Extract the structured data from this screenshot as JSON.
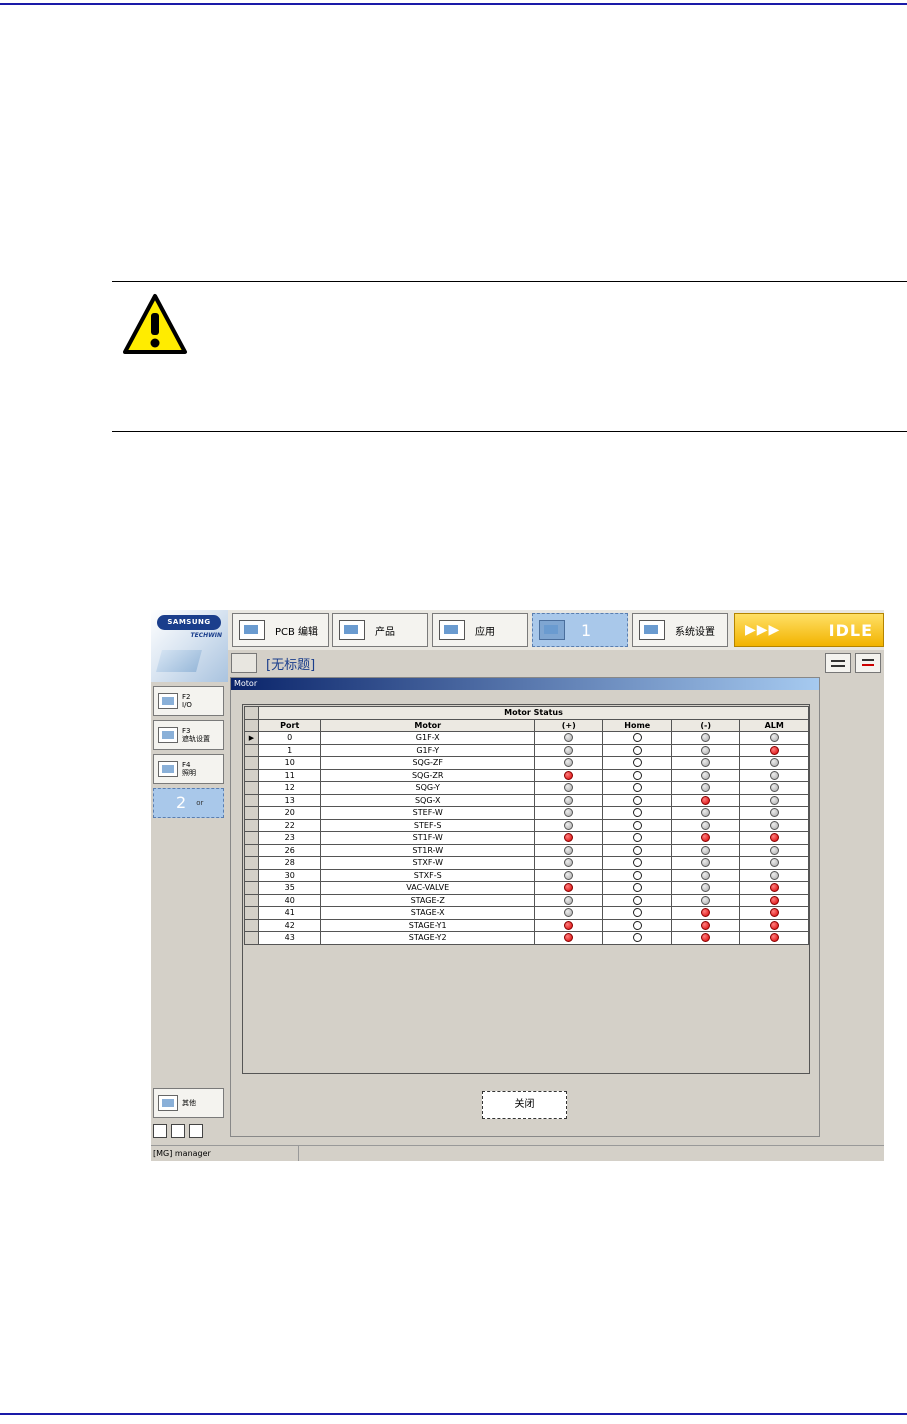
{
  "app": {
    "logo_brand": "SAMSUNG",
    "logo_sub": "TECHWIN",
    "tabs": [
      {
        "label": "PCB 编辑"
      },
      {
        "label": "产品"
      },
      {
        "label": "应用"
      },
      {
        "label": "1"
      },
      {
        "label": "系统设置"
      }
    ],
    "idle_arrows": "▶▶▶",
    "idle_label": "IDLE",
    "document_title": "[无标题]",
    "sidebar": [
      {
        "key": "F2",
        "label": "I/O"
      },
      {
        "key": "F3",
        "label": "遮轨设置"
      },
      {
        "key": "F4",
        "label": "照明"
      },
      {
        "key": "2",
        "label": "or"
      }
    ],
    "sidebar_other": "其他",
    "window_caption": "Motor",
    "table_title": "Motor Status",
    "columns": [
      "Port",
      "Motor",
      "(+)",
      "Home",
      "(-)",
      "ALM"
    ],
    "selected_row_marker": "▶",
    "rows": [
      {
        "port": "0",
        "motor": "G1F-X",
        "plus": "gray",
        "home": "white",
        "minus": "gray",
        "alm": "gray"
      },
      {
        "port": "1",
        "motor": "G1F-Y",
        "plus": "gray",
        "home": "white",
        "minus": "gray",
        "alm": "red"
      },
      {
        "port": "10",
        "motor": "SQG-ZF",
        "plus": "gray",
        "home": "white",
        "minus": "gray",
        "alm": "gray"
      },
      {
        "port": "11",
        "motor": "SQG-ZR",
        "plus": "red",
        "home": "white",
        "minus": "gray",
        "alm": "gray"
      },
      {
        "port": "12",
        "motor": "SQG-Y",
        "plus": "gray",
        "home": "white",
        "minus": "gray",
        "alm": "gray"
      },
      {
        "port": "13",
        "motor": "SQG-X",
        "plus": "gray",
        "home": "white",
        "minus": "red",
        "alm": "gray"
      },
      {
        "port": "20",
        "motor": "STEF-W",
        "plus": "gray",
        "home": "white",
        "minus": "gray",
        "alm": "gray"
      },
      {
        "port": "22",
        "motor": "STEF-S",
        "plus": "gray",
        "home": "white",
        "minus": "gray",
        "alm": "gray"
      },
      {
        "port": "23",
        "motor": "ST1F-W",
        "plus": "red",
        "home": "white",
        "minus": "red",
        "alm": "red"
      },
      {
        "port": "26",
        "motor": "ST1R-W",
        "plus": "gray",
        "home": "white",
        "minus": "gray",
        "alm": "gray"
      },
      {
        "port": "28",
        "motor": "STXF-W",
        "plus": "gray",
        "home": "white",
        "minus": "gray",
        "alm": "gray"
      },
      {
        "port": "30",
        "motor": "STXF-S",
        "plus": "gray",
        "home": "white",
        "minus": "gray",
        "alm": "gray"
      },
      {
        "port": "35",
        "motor": "VAC-VALVE",
        "plus": "red",
        "home": "white",
        "minus": "gray",
        "alm": "red"
      },
      {
        "port": "40",
        "motor": "STAGE-Z",
        "plus": "gray",
        "home": "white",
        "minus": "gray",
        "alm": "red"
      },
      {
        "port": "41",
        "motor": "STAGE-X",
        "plus": "gray",
        "home": "white",
        "minus": "red",
        "alm": "red"
      },
      {
        "port": "42",
        "motor": "STAGE-Y1",
        "plus": "red",
        "home": "white",
        "minus": "red",
        "alm": "red"
      },
      {
        "port": "43",
        "motor": "STAGE-Y2",
        "plus": "red",
        "home": "white",
        "minus": "red",
        "alm": "red"
      }
    ],
    "close_button": "关闭",
    "status_user": "[MG] manager"
  },
  "colors": {
    "page_rule": "#1a1aa8",
    "led_red": "#d80000",
    "led_gray": "#aaaaaa",
    "idle_accent": "#f2b300"
  }
}
